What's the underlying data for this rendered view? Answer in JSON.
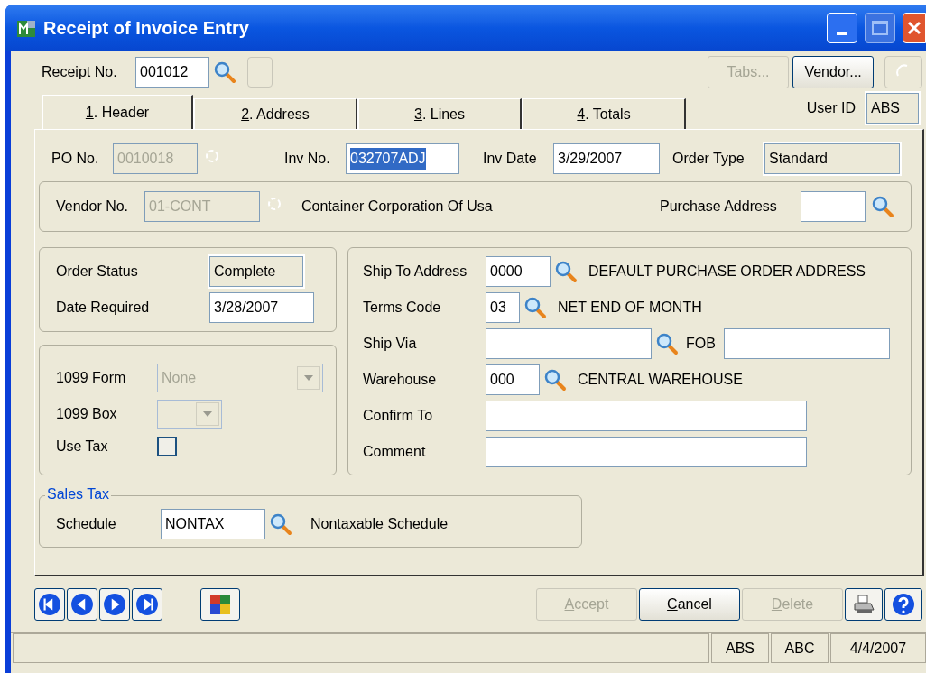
{
  "window": {
    "title": "Receipt of Invoice Entry"
  },
  "receipt": {
    "label": "Receipt No.",
    "value": "001012"
  },
  "top_buttons": [
    {
      "label": "Tabs...",
      "disabled": true
    },
    {
      "label": "Vendor...",
      "disabled": false
    }
  ],
  "user_id": {
    "label": "User ID",
    "value": "ABS"
  },
  "tabs": [
    {
      "label": "1. Header",
      "selected": true
    },
    {
      "label": "2. Address",
      "selected": false
    },
    {
      "label": "3. Lines",
      "selected": false
    },
    {
      "label": "4. Totals",
      "selected": false
    }
  ],
  "po_no": {
    "label": "PO No.",
    "value": "0010018",
    "disabled": true
  },
  "inv_no": {
    "label": "Inv No.",
    "value": "032707ADJ",
    "highlighted": true
  },
  "inv_date": {
    "label": "Inv Date",
    "value": "3/29/2007"
  },
  "order_type": {
    "label": "Order Type",
    "value": "Standard"
  },
  "vendor": {
    "label": "Vendor No.",
    "value": "01-CONT",
    "disabled": true,
    "name": "Container Corporation Of Usa",
    "purchase_address_label": "Purchase Address"
  },
  "order_status": {
    "label": "Order Status",
    "value": "Complete"
  },
  "date_required": {
    "label": "Date Required",
    "value": "3/28/2007"
  },
  "form_1099": {
    "label": "1099 Form",
    "value": "None",
    "disabled": true
  },
  "box_1099": {
    "label": "1099 Box",
    "disabled": true
  },
  "use_tax": {
    "label": "Use Tax",
    "checked": false
  },
  "shipping": [
    {
      "kind": "lookup",
      "label": "Ship To Address",
      "value": "0000",
      "description": "DEFAULT PURCHASE ORDER ADDRESS"
    },
    {
      "kind": "lookup",
      "label": "Terms Code",
      "value": "03",
      "description": "NET END OF MONTH"
    },
    {
      "kind": "via",
      "label": "Ship Via",
      "extra_label": "FOB"
    },
    {
      "kind": "lookup",
      "label": "Warehouse",
      "value": "000",
      "description": "CENTRAL WAREHOUSE"
    },
    {
      "kind": "text",
      "label": "Confirm To"
    },
    {
      "kind": "text",
      "label": "Comment"
    }
  ],
  "sales_tax": {
    "title": "Sales Tax",
    "label": "Schedule",
    "value": "NONTAX",
    "description": "Nontaxable Schedule"
  },
  "footer_buttons": [
    {
      "label": "Accept",
      "disabled": true
    },
    {
      "label": "Cancel",
      "disabled": false
    },
    {
      "label": "Delete",
      "disabled": true
    }
  ],
  "status_bar": [
    "ABS",
    "ABC",
    "4/4/2007"
  ]
}
